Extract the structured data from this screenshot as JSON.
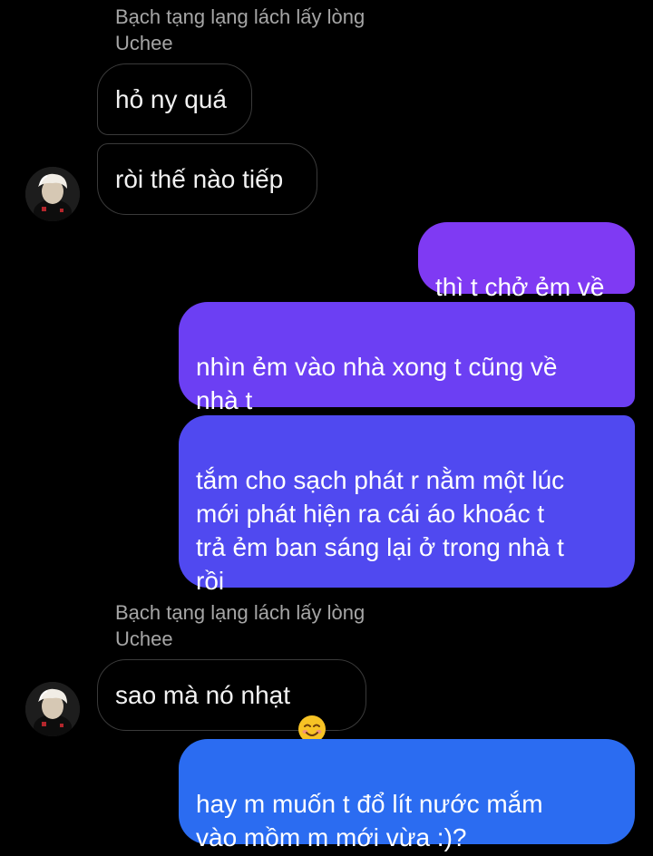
{
  "conversation": {
    "contact_name_line1": "Bạch tạng lạng lách lấy lòng",
    "contact_name_line2": "Uchee",
    "messages": [
      {
        "from": "them",
        "text": "hỏ ny quá"
      },
      {
        "from": "them",
        "text": "ròi thế nào tiếp"
      },
      {
        "from": "me",
        "text": "thì t chở ẻm về"
      },
      {
        "from": "me",
        "text": "nhìn ẻm vào nhà xong t cũng về\nnhà t"
      },
      {
        "from": "me",
        "text": "tắm cho sạch phát r nằm một lúc\nmới phát hiện ra cái áo khoác t\ntrả ẻm ban sáng lại ở trong nhà t\nrồi"
      },
      {
        "from": "them",
        "text": "sao mà nó nhạt",
        "emoji": "smiling-face-icon"
      },
      {
        "from": "me",
        "text": "hay m muốn t đổ lít nước mắm\nvào mồm m mới vừa :)?"
      }
    ]
  },
  "colors": {
    "background": "#000000",
    "incoming_border": "#3a3a3a",
    "sender_name": "#a6a6a6",
    "outgoing_gradient_top": "#8a33f2",
    "outgoing_gradient_bottom": "#2a6ef0"
  }
}
